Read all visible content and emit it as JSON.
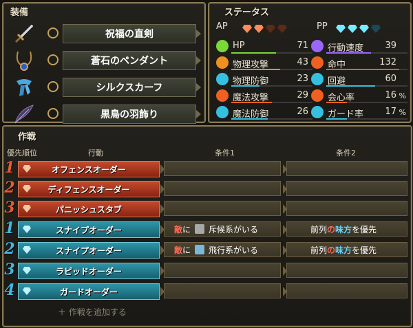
{
  "equipment": {
    "title": "装備",
    "items": [
      {
        "name": "祝福の直剣",
        "icon": "sword-icon"
      },
      {
        "name": "蒼石のペンダント",
        "icon": "pendant-icon"
      },
      {
        "name": "シルクスカーフ",
        "icon": "scarf-icon"
      },
      {
        "name": "黒鳥の羽飾り",
        "icon": "feather-icon"
      }
    ]
  },
  "status": {
    "title": "ステータス",
    "ap_label": "AP",
    "pp_label": "PP",
    "ap": {
      "filled": 2,
      "total": 4
    },
    "pp": {
      "filled": 3,
      "total": 4
    },
    "left": [
      {
        "label": "HP",
        "value": "71",
        "color": "#7ad83a",
        "ratio": 0.55
      },
      {
        "label": "物理攻撃",
        "value": "43",
        "color": "#f09020",
        "ratio": 0.6
      },
      {
        "label": "物理防御",
        "value": "23",
        "color": "#36c0e0",
        "ratio": 0.35
      },
      {
        "label": "魔法攻撃",
        "value": "29",
        "color": "#f06020",
        "ratio": 0.5
      },
      {
        "label": "魔法防御",
        "value": "26",
        "color": "#36c0e0",
        "ratio": 0.45
      }
    ],
    "right": [
      {
        "label": "行動速度",
        "value": "39",
        "unit": "",
        "color": "#9a66ff",
        "ratio": 0.55
      },
      {
        "label": "命中",
        "value": "132",
        "unit": "",
        "color": "#f06020",
        "ratio": 0.9
      },
      {
        "label": "回避",
        "value": "60",
        "unit": "",
        "color": "#36c0e0",
        "ratio": 0.6
      },
      {
        "label": "会心率",
        "value": "16",
        "unit": "%",
        "color": "#f06020",
        "ratio": 0.25
      },
      {
        "label": "ガード率",
        "value": "17",
        "unit": "%",
        "color": "#36c0e0",
        "ratio": 0.25
      }
    ]
  },
  "tactics": {
    "title": "作戦",
    "headers": {
      "priority": "優先順位",
      "action": "行動",
      "cond1": "条件1",
      "cond2": "条件2"
    },
    "rows": [
      {
        "num": "1",
        "type": "red",
        "action": "オフェンスオーダー"
      },
      {
        "num": "2",
        "type": "red",
        "action": "ディフェンスオーダー"
      },
      {
        "num": "3",
        "type": "red",
        "action": "パニッシュスタブ"
      },
      {
        "num": "1",
        "type": "blue",
        "action": "スナイプオーダー",
        "c1_a": "敵",
        "c1_b": "に",
        "c1_c": "斥候系がいる",
        "c2_a": "前列",
        "c2_b": "の",
        "c2_c": "味方",
        "c2_d": "を優先"
      },
      {
        "num": "2",
        "type": "blue",
        "action": "スナイプオーダー",
        "c1_a": "敵",
        "c1_b": "に",
        "c1_c": "飛行系がいる",
        "c2_a": "前列",
        "c2_b": "の",
        "c2_c": "味方",
        "c2_d": "を優先"
      },
      {
        "num": "3",
        "type": "blue",
        "action": "ラピッドオーダー"
      },
      {
        "num": "4",
        "type": "blue",
        "action": "ガードオーダー"
      }
    ],
    "add_label": "＋ 作戦を追加する"
  }
}
